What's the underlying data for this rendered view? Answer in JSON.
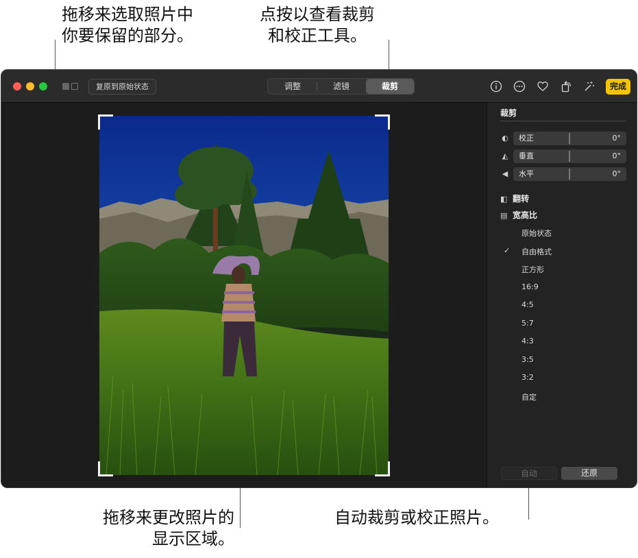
{
  "callouts": {
    "top_left_line1": "拖移来选取照片中",
    "top_left_line2": "你要保留的部分。",
    "top_mid_line1": "点按以查看裁剪",
    "top_mid_line2": "和校正工具。",
    "bottom_left_line1": "拖移来更改照片的",
    "bottom_left_line2": "显示区域。",
    "bottom_right": "自动裁剪或校正照片。"
  },
  "toolbar": {
    "revert_label": "复原到原始状态",
    "tabs": [
      {
        "label": "调整",
        "active": false
      },
      {
        "label": "滤镜",
        "active": false
      },
      {
        "label": "裁剪",
        "active": true
      }
    ],
    "done_label": "完成",
    "icons": [
      "info-icon",
      "more-icon",
      "heart-icon",
      "rotate-icon",
      "magic-wand-icon"
    ],
    "traffic_colors": [
      "#ff5f57",
      "#febc2e",
      "#28c840"
    ],
    "accent": "#f5c400"
  },
  "panel": {
    "title": "裁剪",
    "sliders": [
      {
        "label": "校正",
        "value": "0°",
        "icon": "straighten-icon"
      },
      {
        "label": "垂直",
        "value": "0°",
        "icon": "vertical-icon"
      },
      {
        "label": "水平",
        "value": "0°",
        "icon": "horizontal-icon"
      }
    ],
    "flip_label": "翻转",
    "aspect_label": "宽高比",
    "aspect_options": [
      "原始状态",
      "自由格式",
      "正方形",
      "16:9",
      "4:5",
      "5:7",
      "4:3",
      "3:5",
      "3:2",
      "自定"
    ],
    "selected_option": "自由格式",
    "check_mark": "✓",
    "auto_label": "自动",
    "reset_label": "还原"
  }
}
